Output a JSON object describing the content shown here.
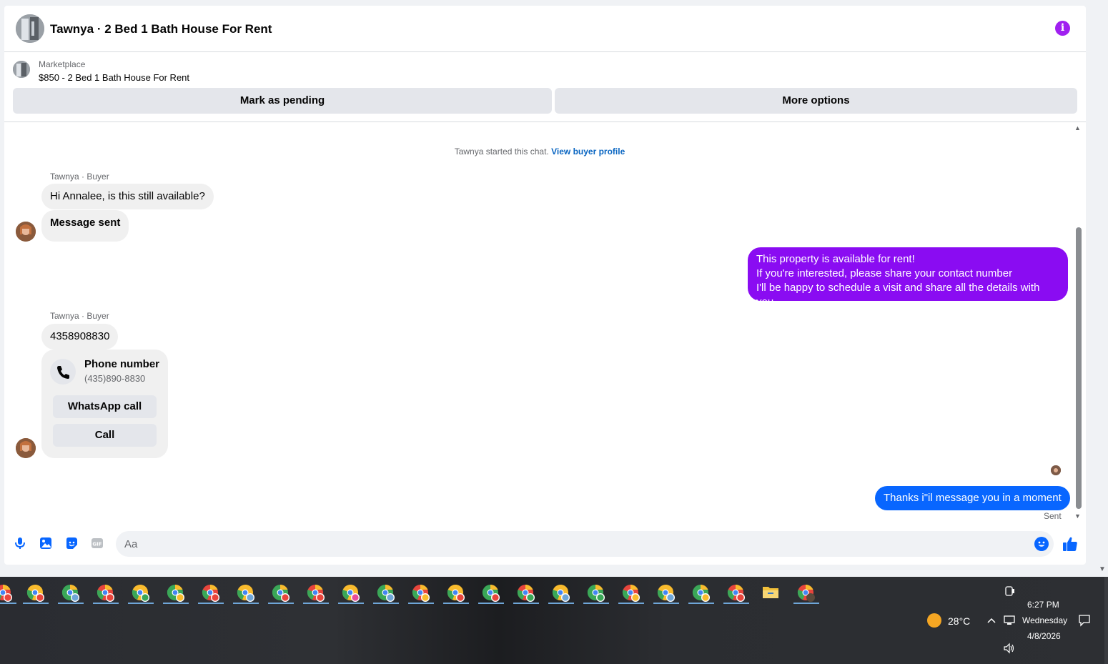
{
  "header": {
    "title": "Tawnya · 2 Bed 1 Bath House For Rent",
    "info_icon": "info-icon"
  },
  "listing": {
    "kind": "Marketplace",
    "price_title": "$850 - 2 Bed 1 Bath House For Rent",
    "mark_pending": "Mark as pending",
    "more_options": "More options"
  },
  "chat": {
    "started_text": "Tawnya started this chat.",
    "view_profile": "View buyer profile",
    "sender_label_1": "Tawnya · Buyer",
    "msg_in_1": "Hi Annalee, is this still available?",
    "msg_in_2": "Message sent",
    "msg_out_1_line1": "This property is available for rent!",
    "msg_out_1_line2": "If you're interested, please share your contact number",
    "msg_out_1_line3": "I'll be happy to schedule a visit and share all the details with you",
    "sender_label_2": "Tawnya · Buyer",
    "msg_in_3": "4358908830",
    "phone_card": {
      "title": "Phone number",
      "number": "(435)890-8830",
      "whatsapp": "WhatsApp call",
      "call": "Call"
    },
    "msg_out_2": "Thanks i\"il message you in a moment",
    "status": "Sent"
  },
  "composer": {
    "placeholder": "Aa"
  },
  "taskbar": {
    "weather": "28°C",
    "time": "6:27 PM",
    "day": "Wednesday",
    "date": "4/8/2026"
  },
  "colors": {
    "outgoing_purple": "#8a0cf2",
    "outgoing_blue": "#0866ff",
    "link": "#0a66c2",
    "info": "#a020f0"
  }
}
